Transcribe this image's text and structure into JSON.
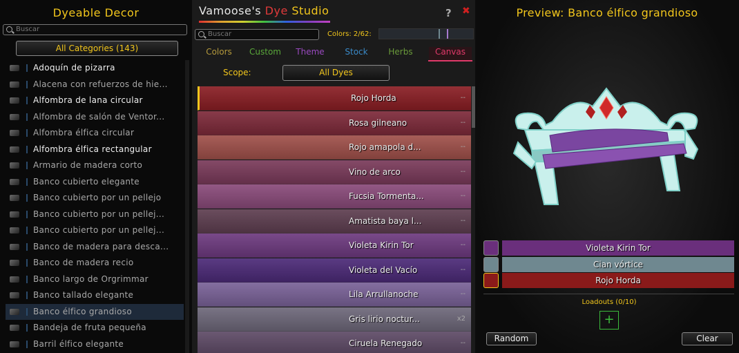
{
  "left": {
    "title": "Dyeable Decor",
    "search_placeholder": "Buscar",
    "category_button": "All Categories (143)",
    "items": [
      {
        "label": "Adoquín de pizarra",
        "bright": true
      },
      {
        "label": "Alacena con refuerzos de hie...",
        "bright": false
      },
      {
        "label": "Alfombra de lana circular",
        "bright": true
      },
      {
        "label": "Alfombra de salón de Ventor...",
        "bright": false
      },
      {
        "label": "Alfombra élfica circular",
        "bright": false
      },
      {
        "label": "Alfombra élfica rectangular",
        "bright": true
      },
      {
        "label": "Armario de madera corto",
        "bright": false
      },
      {
        "label": "Banco cubierto elegante",
        "bright": false
      },
      {
        "label": "Banco cubierto por un pellejo",
        "bright": false
      },
      {
        "label": "Banco cubierto por un pellej...",
        "bright": false
      },
      {
        "label": "Banco cubierto por un pellej...",
        "bright": false
      },
      {
        "label": "Banco de madera para desca...",
        "bright": false
      },
      {
        "label": "Banco de madera recio",
        "bright": false
      },
      {
        "label": "Banco largo de Orgrimmar",
        "bright": false
      },
      {
        "label": "Banco tallado elegante",
        "bright": false
      },
      {
        "label": "Banco élfico grandioso",
        "bright": false,
        "selected": true
      },
      {
        "label": "Bandeja de fruta pequeña",
        "bright": false
      },
      {
        "label": "Barril élfico elegante",
        "bright": false
      }
    ]
  },
  "studio": {
    "title_parts": [
      "Vamoose's ",
      "Dye ",
      "Studio"
    ],
    "help": "?",
    "close": "✖",
    "search_placeholder": "Buscar",
    "colors_label": "Colors: 2/62:",
    "tabs": [
      {
        "label": "Colors",
        "color": "#b59a3c"
      },
      {
        "label": "Custom",
        "color": "#5aa83a"
      },
      {
        "label": "Theme",
        "color": "#9a4ac0"
      },
      {
        "label": "Stock",
        "color": "#3a8ac8"
      },
      {
        "label": "Herbs",
        "color": "#6a9a3a"
      },
      {
        "label": "Canvas",
        "color": "#e03a6a",
        "active": true
      }
    ],
    "scope_label": "Scope:",
    "scope_value": "All Dyes",
    "dyes": [
      {
        "name": "Rojo Horda",
        "count": "--",
        "color": "#8a1e24",
        "selected": true
      },
      {
        "name": "Rosa gilneano",
        "count": "--",
        "color": "#7e2a3a"
      },
      {
        "name": "Rojo amapola d...",
        "count": "--",
        "color": "#a0504a"
      },
      {
        "name": "Vino de arco",
        "count": "--",
        "color": "#7a3a5a"
      },
      {
        "name": "Fucsia Tormenta...",
        "count": "--",
        "color": "#8a4a7a"
      },
      {
        "name": "Amatista baya l...",
        "count": "--",
        "color": "#5e3e50"
      },
      {
        "name": "Violeta Kirin Tor",
        "count": "--",
        "color": "#6e3a80"
      },
      {
        "name": "Violeta del Vacío",
        "count": "--",
        "color": "#4c2a78"
      },
      {
        "name": "Lila Arrullanoche",
        "count": "--",
        "color": "#7a6298"
      },
      {
        "name": "Gris lirio noctur...",
        "count": "x2",
        "color": "#6e687a"
      },
      {
        "name": "Ciruela Renegado",
        "count": "--",
        "color": "#5e4a66"
      }
    ]
  },
  "preview": {
    "title": "Preview: Banco élfico grandioso",
    "slots": [
      {
        "name": "Violeta Kirin Tor",
        "color": "#6a2f7c"
      },
      {
        "name": "Cian vórtice",
        "color": "#6f8890"
      },
      {
        "name": "Rojo Horda",
        "color": "#8a1a1a"
      }
    ],
    "loadouts_label": "Loadouts (0/10)",
    "add": "+",
    "random": "Random",
    "clear": "Clear"
  }
}
